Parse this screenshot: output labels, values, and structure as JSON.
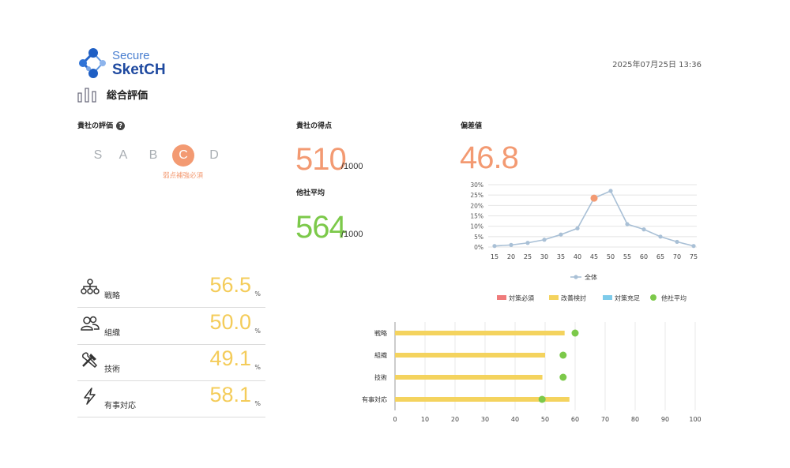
{
  "brand": {
    "line1": "Secure",
    "line2": "SketCH"
  },
  "timestamp": "2025年07月25日 13:36",
  "page_title": "総合評価",
  "rating": {
    "label": "貴社の評価",
    "help_icon": "question-circle-icon",
    "grades": [
      "S",
      "A",
      "B",
      "C",
      "D"
    ],
    "selected": "C",
    "note": "弱点補強必須",
    "accent": "#f39a72"
  },
  "score": {
    "label": "貴社の得点",
    "value": "510",
    "denom": "/1000",
    "color": "#f39a72"
  },
  "peer": {
    "label": "他社平均",
    "value": "564",
    "denom": "/1000",
    "color": "#7cc94a"
  },
  "deviation": {
    "label": "偏差値",
    "value": "46.8",
    "color": "#f39a72"
  },
  "categories": [
    {
      "name": "戦略",
      "value": "56.5",
      "unit": "%",
      "icon": "hierarchy-icon"
    },
    {
      "name": "組織",
      "value": "50.0",
      "unit": "%",
      "icon": "users-icon"
    },
    {
      "name": "技術",
      "value": "49.1",
      "unit": "%",
      "icon": "tools-icon"
    },
    {
      "name": "有事対応",
      "value": "58.1",
      "unit": "%",
      "icon": "lightning-icon"
    }
  ],
  "chart_data": [
    {
      "type": "line",
      "x": [
        15,
        20,
        25,
        30,
        35,
        40,
        45,
        50,
        55,
        60,
        65,
        70,
        75
      ],
      "series": [
        {
          "name": "全体",
          "values": [
            0.5,
            1,
            2,
            3.5,
            6,
            9,
            23.5,
            27,
            11,
            8.5,
            5,
            2.5,
            0.5
          ],
          "color": "#a9c0d6"
        }
      ],
      "highlight": {
        "x": 45,
        "y": 23.5,
        "color": "#f39a72"
      },
      "y_ticks": [
        "0%",
        "5%",
        "10%",
        "15%",
        "20%",
        "25%",
        "30%"
      ],
      "ylim": [
        0,
        30
      ],
      "grid": true,
      "legend": "bottom"
    },
    {
      "type": "bar",
      "orientation": "horizontal",
      "categories": [
        "戦略",
        "組織",
        "技術",
        "有事対応"
      ],
      "series": [
        {
          "name": "改善検討",
          "values": [
            56.5,
            50.0,
            49.1,
            58.1
          ],
          "color": "#f4d35e"
        },
        {
          "name": "他社平均",
          "type": "dot",
          "values": [
            60,
            56,
            56,
            49
          ],
          "color": "#7cc94a"
        }
      ],
      "legend_items": [
        {
          "name": "対策必須",
          "color": "#ef7b7b"
        },
        {
          "name": "改善検討",
          "color": "#f4d35e"
        },
        {
          "name": "対策充足",
          "color": "#7ecbea"
        },
        {
          "name": "他社平均",
          "color": "#7cc94a"
        }
      ],
      "x_ticks": [
        "0",
        "10",
        "20",
        "30",
        "40",
        "50",
        "60",
        "70",
        "80",
        "90",
        "100"
      ],
      "xlim": [
        0,
        100
      ],
      "grid": true,
      "legend": "top"
    }
  ]
}
